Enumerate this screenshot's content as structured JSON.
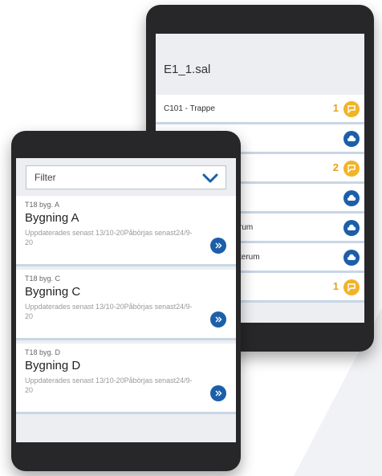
{
  "back_phone": {
    "title": "E1_1.sal",
    "rows": [
      {
        "label": "C101 - Trappe",
        "count": "1",
        "icon": "flag-icon"
      },
      {
        "label": "",
        "count": "",
        "icon": "cloud-icon"
      },
      {
        "label": "",
        "count": "2",
        "icon": "flag-icon"
      },
      {
        "label": "",
        "count": "",
        "icon": "cloud-icon"
      },
      {
        "label": "rum",
        "count": "",
        "icon": "cloud-icon"
      },
      {
        "label": "terum",
        "count": "",
        "icon": "cloud-icon"
      },
      {
        "label": "",
        "count": "1",
        "icon": "flag-icon"
      }
    ]
  },
  "front_phone": {
    "filter": {
      "label": "Filter"
    },
    "buildings": [
      {
        "code": "T18 byg. A",
        "name": "Bygning A",
        "meta": "Uppdaterades senast 13/10-20Påbörjas senast24/9-20"
      },
      {
        "code": "T18 byg. C",
        "name": "Bygning C",
        "meta": "Uppdaterades senast 13/10-20Påbörjas senast24/9-20"
      },
      {
        "code": "T18 byg. D",
        "name": "Bygning D",
        "meta": "Uppdaterades senast 13/10-20Påbörjas senast24/9-20"
      }
    ]
  },
  "colors": {
    "phone_frame": "#27272a",
    "accent_blue": "#1c5fa8",
    "accent_orange": "#f0b429",
    "card_border": "#c8d6e6"
  }
}
